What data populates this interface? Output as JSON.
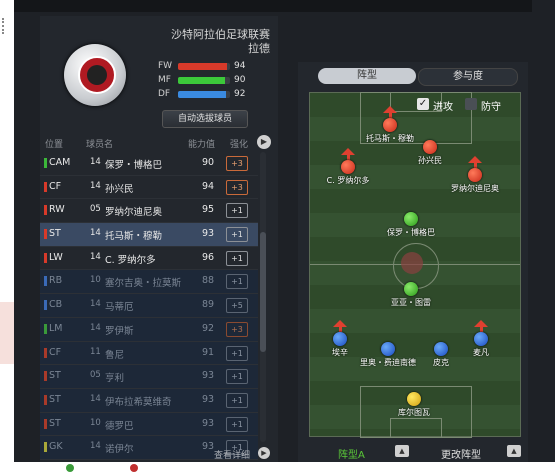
{
  "team": {
    "league": "沙特阿拉伯足球联赛",
    "name": "拉德",
    "stats": [
      {
        "label": "FW",
        "value": "94",
        "pct": 0.94,
        "color": "#d83a2a"
      },
      {
        "label": "MF",
        "value": "90",
        "pct": 0.9,
        "color": "#3cc83a"
      },
      {
        "label": "DF",
        "value": "92",
        "pct": 0.92,
        "color": "#3a8ae0"
      }
    ],
    "auto_select_label": "自动选拔球员"
  },
  "list_header": {
    "position": "位置",
    "player_name": "球员名",
    "ability": "能力值",
    "boost": "强化",
    "next_icon": "▶"
  },
  "players": [
    {
      "pos": "CAM",
      "posColor": "#3cb83a",
      "num": "14",
      "name": "保罗・博格巴",
      "ability": "90",
      "boost": "+3",
      "hot": true,
      "type": "starter"
    },
    {
      "pos": "CF",
      "posColor": "#d83a2a",
      "num": "14",
      "name": "孙兴民",
      "ability": "94",
      "boost": "+3",
      "hot": true,
      "type": "starter"
    },
    {
      "pos": "RW",
      "posColor": "#d83a2a",
      "num": "05",
      "name": "罗纳尔迪尼奥",
      "ability": "95",
      "boost": "+1",
      "hot": false,
      "type": "starter"
    },
    {
      "pos": "ST",
      "posColor": "#d83a2a",
      "num": "14",
      "name": "托马斯・穆勒",
      "ability": "93",
      "boost": "+1",
      "hot": false,
      "type": "selected"
    },
    {
      "pos": "LW",
      "posColor": "#d83a2a",
      "num": "14",
      "name": "C. 罗纳尔多",
      "ability": "96",
      "boost": "+1",
      "hot": false,
      "type": "starter"
    },
    {
      "pos": "RB",
      "posColor": "#3a6ab8",
      "num": "10",
      "name": "塞尔吉奥・拉莫斯",
      "ability": "88",
      "boost": "+1",
      "hot": false,
      "type": "sub"
    },
    {
      "pos": "CB",
      "posColor": "#3a6ab8",
      "num": "14",
      "name": "马蒂厄",
      "ability": "89",
      "boost": "+5",
      "hot": false,
      "type": "sub"
    },
    {
      "pos": "LM",
      "posColor": "#3a9a3a",
      "num": "14",
      "name": "罗伊斯",
      "ability": "92",
      "boost": "+3",
      "hot": true,
      "type": "sub"
    },
    {
      "pos": "CF",
      "posColor": "#a83a2a",
      "num": "11",
      "name": "鲁尼",
      "ability": "91",
      "boost": "+1",
      "hot": false,
      "type": "sub"
    },
    {
      "pos": "ST",
      "posColor": "#a83a2a",
      "num": "05",
      "name": "亨利",
      "ability": "93",
      "boost": "+1",
      "hot": false,
      "type": "sub"
    },
    {
      "pos": "ST",
      "posColor": "#a83a2a",
      "num": "14",
      "name": "伊布拉希莫维奇",
      "ability": "93",
      "boost": "+1",
      "hot": false,
      "type": "sub"
    },
    {
      "pos": "ST",
      "posColor": "#a83a2a",
      "num": "10",
      "name": "德罗巴",
      "ability": "93",
      "boost": "+1",
      "hot": false,
      "type": "sub"
    },
    {
      "pos": "GK",
      "posColor": "#a8a83a",
      "num": "14",
      "name": "诺伊尔",
      "ability": "93",
      "boost": "+1",
      "hot": false,
      "type": "sub"
    }
  ],
  "footer": {
    "view_detail": "查看详细",
    "next_icon": "▶"
  },
  "tabs": [
    {
      "label": "阵型",
      "active": false
    },
    {
      "label": "参与度",
      "active": true
    }
  ],
  "pitch": {
    "attack_label": "进攻",
    "defense_label": "防守",
    "check_mark": "✓",
    "players": [
      {
        "name": "托马斯・穆勒",
        "color": "red",
        "arrow": true
      },
      {
        "name": "孙兴民",
        "color": "red",
        "arrow": false
      },
      {
        "name": "C. 罗纳尔多",
        "color": "red",
        "arrow": true
      },
      {
        "name": "罗纳尔迪尼奥",
        "color": "red",
        "arrow": true
      },
      {
        "name": "保罗・博格巴",
        "color": "green",
        "arrow": false
      },
      {
        "name": "亚亚・图雷",
        "color": "green",
        "arrow": false
      },
      {
        "name": "埃辛",
        "color": "blue",
        "arrow": true
      },
      {
        "name": "里奥・费迪南德",
        "color": "blue",
        "arrow": false
      },
      {
        "name": "皮克",
        "color": "blue",
        "arrow": false
      },
      {
        "name": "麦凡",
        "color": "blue",
        "arrow": true
      },
      {
        "name": "库尔图瓦",
        "color": "yellow",
        "arrow": false
      }
    ]
  },
  "bottom": {
    "formation": "阵型A",
    "up_icon": "▲",
    "change_formation": "更改阵型"
  }
}
